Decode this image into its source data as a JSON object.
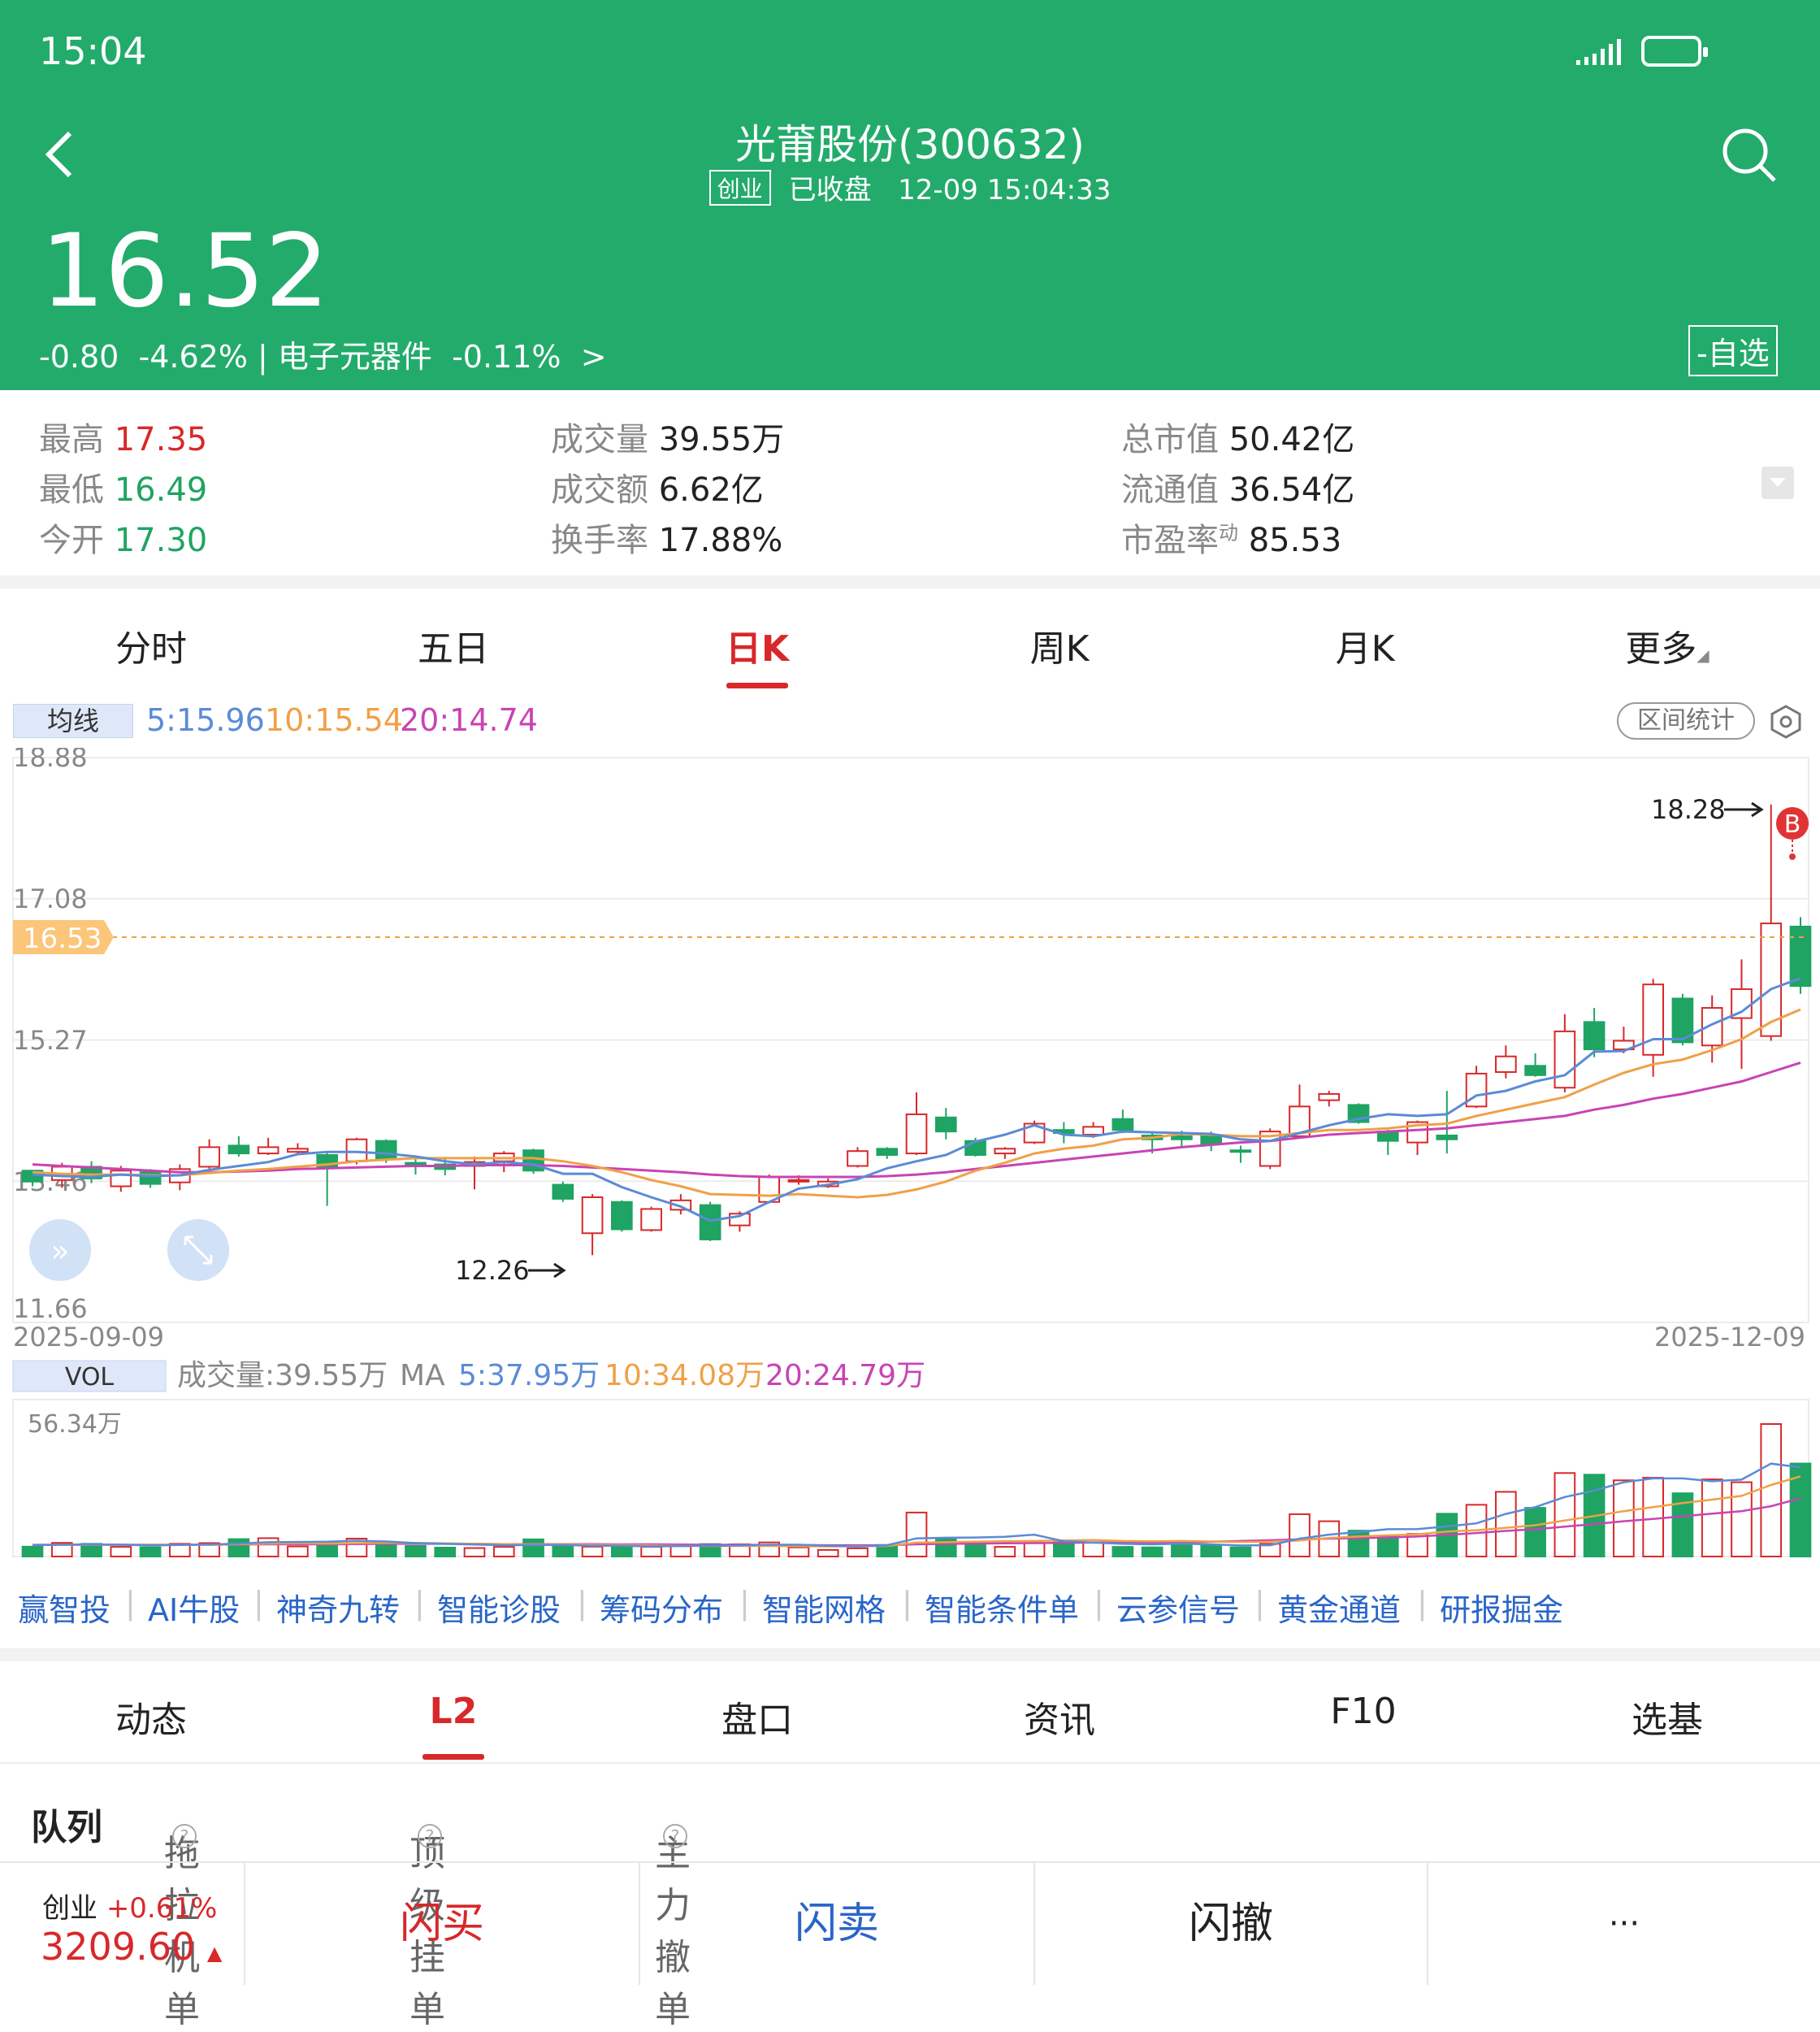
{
  "status": {
    "time": "15:04"
  },
  "header": {
    "title": "光莆股份(300632)",
    "board": "创业",
    "state": "已收盘",
    "datetime": "12-09 15:04:33",
    "price": "16.52",
    "change": "-0.80",
    "change_pct": "-4.62%",
    "sector": "电子元器件",
    "sector_pct": "-0.11%",
    "watch_label": "-自选"
  },
  "stats": {
    "high_k": "最高",
    "high_v": "17.35",
    "low_k": "最低",
    "low_v": "16.49",
    "open_k": "今开",
    "open_v": "17.30",
    "vol_k": "成交量",
    "vol_v": "39.55万",
    "amt_k": "成交额",
    "amt_v": "6.62亿",
    "turn_k": "换手率",
    "turn_v": "17.88%",
    "mcap_k": "总市值",
    "mcap_v": "50.42亿",
    "float_k": "流通值",
    "float_v": "36.54亿",
    "pe_k": "市盈率",
    "pe_sup": "动",
    "pe_v": "85.53"
  },
  "kline_tabs": [
    "分时",
    "五日",
    "日K",
    "周K",
    "月K",
    "更多"
  ],
  "ma_bar": {
    "badge": "均线",
    "ma5": "5:15.96",
    "ma10": "10:15.54",
    "ma20": "20:14.74",
    "range_btn": "区间统计"
  },
  "price_chart": {
    "y_ticks": [
      "18.88",
      "17.08",
      "15.27",
      "13.46",
      "11.66"
    ],
    "last_price_label": "16.53",
    "max_label": "18.28",
    "min_label": "12.26",
    "start_date": "2025-09-09",
    "end_date": "2025-12-09",
    "signal": "B"
  },
  "vol_bar": {
    "badge": "VOL",
    "vol": "成交量:39.55万",
    "ma": "MA",
    "ma5": "5:37.95万",
    "ma10": "10:34.08万",
    "ma20": "20:24.79万",
    "y_max": "56.34万"
  },
  "colors": {
    "up": "#d8282a",
    "down": "#1fa463",
    "ma5": "#5b8bd6",
    "ma10": "#f0a048",
    "ma20": "#c844b4",
    "header": "#23ab6c"
  },
  "chart_data": {
    "type": "candlestick",
    "ylim": [
      11.66,
      18.88
    ],
    "ohlc": [
      [
        13.6,
        13.46,
        13.4,
        13.58
      ],
      [
        13.48,
        13.65,
        13.38,
        13.7
      ],
      [
        13.65,
        13.5,
        13.44,
        13.72
      ],
      [
        13.4,
        13.6,
        13.33,
        13.66
      ],
      [
        13.58,
        13.43,
        13.38,
        13.62
      ],
      [
        13.45,
        13.62,
        13.35,
        13.68
      ],
      [
        13.65,
        13.9,
        13.62,
        14.0
      ],
      [
        13.92,
        13.82,
        13.78,
        14.04
      ],
      [
        13.82,
        13.9,
        13.8,
        14.02
      ],
      [
        13.84,
        13.88,
        13.8,
        13.95
      ],
      [
        13.8,
        13.65,
        13.15,
        13.84
      ],
      [
        13.72,
        14.0,
        13.68,
        14.02
      ],
      [
        13.98,
        13.75,
        13.7,
        14.0
      ],
      [
        13.7,
        13.66,
        13.55,
        13.78
      ],
      [
        13.68,
        13.62,
        13.54,
        13.75
      ],
      [
        13.66,
        13.71,
        13.36,
        13.78
      ],
      [
        13.72,
        13.82,
        13.58,
        13.85
      ],
      [
        13.86,
        13.6,
        13.56,
        13.88
      ],
      [
        13.42,
        13.24,
        13.2,
        13.46
      ],
      [
        12.8,
        13.26,
        12.52,
        13.3
      ],
      [
        13.2,
        12.85,
        12.82,
        13.22
      ],
      [
        12.84,
        13.11,
        12.82,
        13.14
      ],
      [
        13.1,
        13.22,
        13.04,
        13.3
      ],
      [
        13.16,
        12.72,
        12.7,
        13.2
      ],
      [
        12.9,
        13.05,
        12.82,
        13.08
      ],
      [
        13.2,
        13.52,
        13.18,
        13.55
      ],
      [
        13.46,
        13.48,
        13.42,
        13.54
      ],
      [
        13.4,
        13.46,
        13.38,
        13.5
      ],
      [
        13.66,
        13.85,
        13.64,
        13.9
      ],
      [
        13.88,
        13.8,
        13.75,
        13.9
      ],
      [
        13.82,
        14.32,
        13.8,
        14.6
      ],
      [
        14.28,
        14.1,
        14.0,
        14.4
      ],
      [
        13.98,
        13.8,
        13.78,
        14.02
      ],
      [
        13.82,
        13.88,
        13.75,
        13.9
      ],
      [
        13.96,
        14.2,
        13.94,
        14.24
      ],
      [
        14.12,
        14.08,
        13.95,
        14.22
      ],
      [
        14.06,
        14.16,
        14.02,
        14.22
      ],
      [
        14.26,
        14.12,
        14.08,
        14.38
      ],
      [
        14.05,
        14.0,
        13.82,
        14.09
      ],
      [
        14.04,
        14.0,
        13.9,
        14.11
      ],
      [
        14.05,
        13.94,
        13.85,
        14.1
      ],
      [
        13.86,
        13.84,
        13.7,
        13.92
      ],
      [
        13.66,
        14.1,
        13.62,
        14.14
      ],
      [
        14.04,
        14.42,
        14.02,
        14.7
      ],
      [
        14.5,
        14.58,
        14.42,
        14.62
      ],
      [
        14.44,
        14.22,
        14.2,
        14.46
      ],
      [
        14.1,
        13.98,
        13.8,
        14.12
      ],
      [
        13.96,
        14.22,
        13.8,
        14.24
      ],
      [
        14.05,
        14.0,
        13.82,
        14.62
      ],
      [
        14.42,
        14.84,
        14.4,
        14.94
      ],
      [
        14.86,
        15.06,
        14.78,
        15.2
      ],
      [
        14.94,
        14.82,
        14.8,
        15.1
      ],
      [
        14.66,
        15.38,
        14.6,
        15.6
      ],
      [
        15.5,
        15.15,
        15.05,
        15.68
      ],
      [
        15.15,
        15.26,
        15.1,
        15.44
      ],
      [
        15.08,
        15.98,
        14.8,
        16.05
      ],
      [
        15.8,
        15.24,
        15.2,
        15.86
      ],
      [
        15.2,
        15.68,
        14.98,
        15.84
      ],
      [
        15.55,
        15.92,
        14.9,
        16.3
      ],
      [
        15.32,
        16.76,
        15.26,
        18.28
      ],
      [
        16.72,
        15.96,
        15.86,
        16.84
      ]
    ],
    "ma5": [
      13.55,
      13.53,
      13.52,
      13.55,
      13.53,
      13.54,
      13.61,
      13.66,
      13.71,
      13.81,
      13.84,
      13.84,
      13.82,
      13.78,
      13.72,
      13.68,
      13.71,
      13.68,
      13.56,
      13.56,
      13.39,
      13.26,
      13.14,
      12.96,
      13.02,
      13.2,
      13.37,
      13.42,
      13.49,
      13.63,
      13.72,
      13.8,
      13.97,
      14.06,
      14.18,
      14.06,
      14.04,
      14.1,
      14.09,
      14.08,
      14.07,
      14.0,
      13.98,
      14.08,
      14.18,
      14.26,
      14.32,
      14.3,
      14.32,
      14.56,
      14.62,
      14.74,
      14.82,
      15.12,
      15.13,
      15.28,
      15.28,
      15.47,
      15.63,
      15.92,
      16.06
    ],
    "ma10": [
      13.58,
      13.56,
      13.55,
      13.55,
      13.54,
      13.54,
      13.57,
      13.6,
      13.62,
      13.65,
      13.68,
      13.72,
      13.74,
      13.76,
      13.76,
      13.76,
      13.76,
      13.76,
      13.72,
      13.66,
      13.58,
      13.48,
      13.4,
      13.3,
      13.29,
      13.28,
      13.3,
      13.28,
      13.26,
      13.29,
      13.36,
      13.46,
      13.6,
      13.7,
      13.82,
      13.88,
      13.92,
      14.0,
      14.02,
      14.07,
      14.06,
      14.04,
      14.04,
      14.08,
      14.12,
      14.12,
      14.14,
      14.18,
      14.2,
      14.3,
      14.38,
      14.46,
      14.54,
      14.7,
      14.85,
      14.96,
      15.02,
      15.14,
      15.28,
      15.5,
      15.66
    ],
    "ma20": [
      13.68,
      13.66,
      13.64,
      13.62,
      13.6,
      13.58,
      13.58,
      13.59,
      13.6,
      13.62,
      13.63,
      13.64,
      13.65,
      13.66,
      13.66,
      13.67,
      13.67,
      13.67,
      13.66,
      13.64,
      13.62,
      13.6,
      13.58,
      13.55,
      13.53,
      13.52,
      13.52,
      13.52,
      13.52,
      13.53,
      13.55,
      13.58,
      13.62,
      13.66,
      13.7,
      13.74,
      13.78,
      13.82,
      13.86,
      13.9,
      13.93,
      13.96,
      13.98,
      14.02,
      14.06,
      14.08,
      14.1,
      14.12,
      14.14,
      14.18,
      14.22,
      14.26,
      14.3,
      14.38,
      14.44,
      14.52,
      14.58,
      14.66,
      14.74,
      14.86,
      14.98
    ],
    "volume": [
      4.2,
      5.8,
      5.4,
      4.1,
      3.9,
      5.4,
      5.7,
      7.4,
      7.8,
      4.3,
      6.1,
      7.6,
      5.9,
      4.5,
      3.8,
      3.6,
      4.1,
      7.3,
      5.2,
      4.2,
      3.9,
      4.1,
      4.4,
      5.3,
      5.2,
      6.0,
      3.9,
      2.8,
      3.5,
      4.9,
      18.7,
      7.9,
      5.8,
      4.1,
      5.8,
      6.2,
      6.0,
      4.1,
      3.9,
      5.6,
      4.6,
      3.9,
      5.4,
      18.0,
      15.0,
      11.0,
      8.5,
      9.6,
      18.2,
      22.0,
      27.5,
      20.7,
      35.5,
      34.8,
      32.4,
      33.5,
      26.9,
      32.8,
      31.6,
      56.34,
      39.55
    ],
    "ma5_vol": [
      4.8,
      5.0,
      5.2,
      5.0,
      4.7,
      4.9,
      5.1,
      5.5,
      6.1,
      6.2,
      6.3,
      6.7,
      6.4,
      5.7,
      5.4,
      5.1,
      4.8,
      4.9,
      4.9,
      4.6,
      4.6,
      4.3,
      4.5,
      4.6,
      4.7,
      5.0,
      5.0,
      4.6,
      4.3,
      4.8,
      7.7,
      8.0,
      8.1,
      8.4,
      9.3,
      6.5,
      5.9,
      5.4,
      5.2,
      5.5,
      5.2,
      4.7,
      4.8,
      7.6,
      9.3,
      10.4,
      11.6,
      11.7,
      12.8,
      14.1,
      18.1,
      21.0,
      25.3,
      28.0,
      31.6,
      33.2,
      33.2,
      32.0,
      32.7,
      39.5,
      37.95
    ],
    "ma10_vol": [
      4.9,
      4.9,
      5.0,
      5.0,
      4.9,
      4.9,
      5.0,
      5.2,
      5.5,
      5.6,
      5.5,
      5.7,
      5.8,
      5.8,
      5.6,
      5.4,
      5.3,
      5.2,
      5.2,
      5.0,
      4.9,
      4.7,
      4.6,
      4.5,
      4.5,
      4.5,
      4.4,
      4.3,
      4.4,
      4.5,
      5.9,
      6.1,
      6.3,
      6.5,
      6.6,
      6.8,
      7.0,
      6.6,
      6.5,
      6.6,
      6.4,
      6.2,
      6.3,
      6.8,
      7.9,
      8.5,
      9.0,
      9.4,
      10.6,
      11.2,
      12.2,
      13.3,
      15.3,
      17.2,
      19.3,
      21.0,
      22.7,
      24.2,
      25.8,
      30.4,
      34.08
    ],
    "ma20_vol": [
      5.0,
      5.0,
      5.0,
      5.0,
      5.0,
      5.0,
      5.0,
      5.1,
      5.2,
      5.2,
      5.2,
      5.3,
      5.4,
      5.4,
      5.4,
      5.4,
      5.3,
      5.3,
      5.3,
      5.3,
      5.2,
      5.2,
      5.1,
      5.0,
      5.0,
      4.9,
      4.9,
      4.8,
      4.8,
      4.8,
      5.2,
      5.4,
      5.5,
      5.6,
      5.7,
      5.8,
      5.9,
      5.9,
      5.9,
      6.0,
      6.3,
      6.6,
      6.9,
      7.3,
      7.6,
      7.8,
      8.1,
      8.5,
      9.2,
      10.0,
      10.9,
      11.6,
      12.7,
      13.8,
      15.0,
      16.0,
      17.1,
      18.2,
      19.3,
      21.4,
      24.79
    ]
  },
  "tools": [
    "赢智投",
    "AI牛股",
    "神奇九转",
    "智能诊股",
    "筹码分布",
    "智能网格",
    "智能条件单",
    "云参信号",
    "黄金通道",
    "研报掘金"
  ],
  "detail_tabs": [
    "动态",
    "L2",
    "盘口",
    "资讯",
    "F10",
    "选基"
  ],
  "sub_tabs": [
    "队列",
    "拖拉机单",
    "顶级挂单",
    "主力撤单"
  ],
  "bottom": {
    "index_name": "创业",
    "index_pct": "+0.61%",
    "index_value": "3209.60",
    "buy": "闪买",
    "sell": "闪卖",
    "cancel": "闪撤",
    "more": "···"
  }
}
